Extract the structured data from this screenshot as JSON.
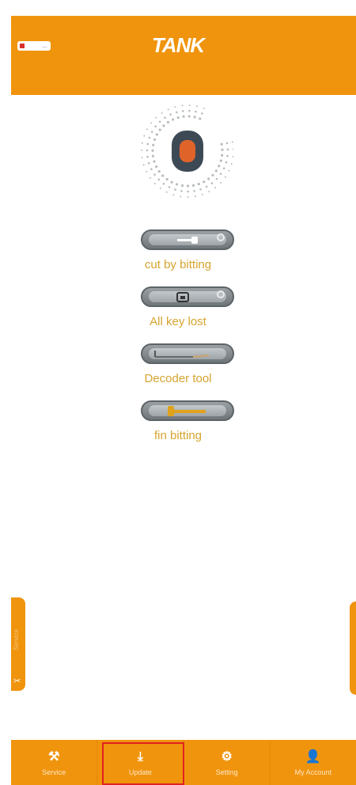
{
  "header": {
    "logo": "TANK",
    "battery_text": "..."
  },
  "profile": {
    "avatar_icon": "user-avatar-icon"
  },
  "menu": [
    {
      "label": "cut by bitting",
      "icon": "key-icon"
    },
    {
      "label": "All key lost",
      "icon": "lock-icon"
    },
    {
      "label": "Decoder tool",
      "icon": "decoder-icon"
    },
    {
      "label": "fin bitting",
      "icon": "golden-key-icon"
    }
  ],
  "side_tabs": {
    "left_text": "Service"
  },
  "bottom_nav": [
    {
      "label": "Service",
      "icon": "service-icon"
    },
    {
      "label": "Update",
      "icon": "download-icon"
    },
    {
      "label": "Setting",
      "icon": "gear-icon"
    },
    {
      "label": "My Account",
      "icon": "account-icon"
    }
  ],
  "highlight": {
    "selected_nav": "Update",
    "color": "#e02020"
  },
  "colors": {
    "accent": "#f0940d",
    "label": "#d6a42e"
  }
}
